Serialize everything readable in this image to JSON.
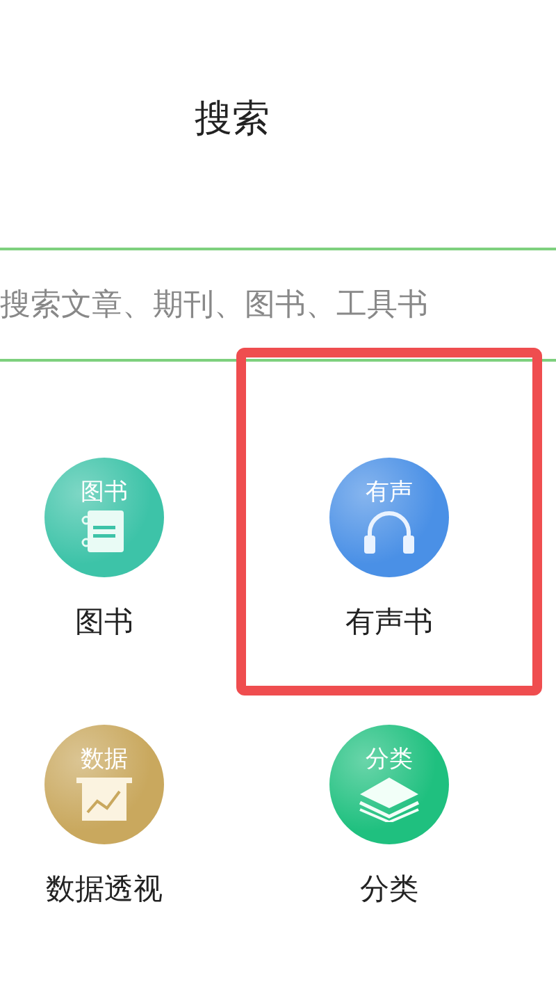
{
  "title": "搜索",
  "search": {
    "placeholder": "搜索文章、期刊、图书、工具书"
  },
  "categories": [
    {
      "label": "图书",
      "badge": "图书",
      "kind": "book",
      "color": "#3dc3a8",
      "highlighted": false
    },
    {
      "label": "有声书",
      "badge": "有声",
      "kind": "headphones",
      "color": "#4a90e6",
      "highlighted": true
    },
    {
      "label": "数据透视",
      "badge": "数据",
      "kind": "chart",
      "color": "#c9a85e",
      "highlighted": false
    },
    {
      "label": "分类",
      "badge": "分类",
      "kind": "layers",
      "color": "#1fc07f",
      "highlighted": false
    }
  ]
}
